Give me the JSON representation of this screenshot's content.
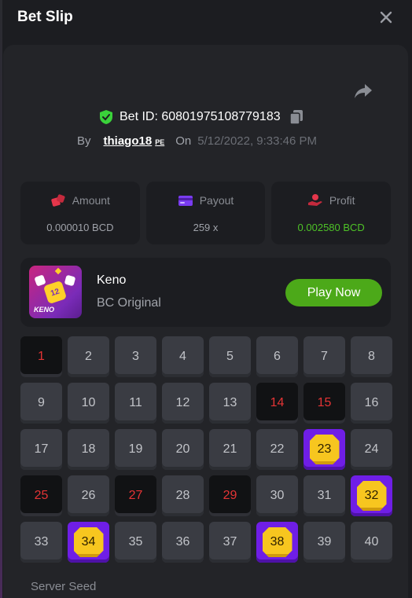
{
  "header": {
    "title": "Bet Slip",
    "close_icon": "close-icon"
  },
  "bet": {
    "id_text": "Bet ID: 60801975108779183",
    "by_label": "By",
    "username": "thiago18",
    "username_suffix": "PE",
    "on_label": "On",
    "datetime": "5/12/2022, 9:33:46 PM"
  },
  "stats": [
    {
      "label": "Amount",
      "value": "0.000010 BCD",
      "icon": "dice-icon",
      "color": "#e5364b"
    },
    {
      "label": "Payout",
      "value": "259 x",
      "icon": "card-icon",
      "color": "#7a3cf0"
    },
    {
      "label": "Profit",
      "value": "0.002580 BCD",
      "icon": "coin-hand-icon",
      "color": "#e5364b",
      "value_color": "#4ec227"
    }
  ],
  "game": {
    "name": "Keno",
    "subtitle": "BC Original",
    "thumb_number": "12",
    "thumb_label": "KENO",
    "play_label": "Play Now"
  },
  "board": {
    "numbers": [
      "1",
      "2",
      "3",
      "4",
      "5",
      "6",
      "7",
      "8",
      "9",
      "10",
      "11",
      "12",
      "13",
      "14",
      "15",
      "16",
      "17",
      "18",
      "19",
      "20",
      "21",
      "22",
      "23",
      "24",
      "25",
      "26",
      "27",
      "28",
      "29",
      "30",
      "31",
      "32",
      "33",
      "34",
      "35",
      "36",
      "37",
      "38",
      "39",
      "40"
    ],
    "missed": [
      "1",
      "14",
      "15",
      "25",
      "27",
      "29"
    ],
    "hits": [
      "23",
      "32",
      "34",
      "38"
    ]
  },
  "footer": {
    "server_seed_label": "Server Seed"
  },
  "colors": {
    "accent_green": "#4ca919",
    "miss_red": "#e53435",
    "hit_purple": "#6f1ee6",
    "gem_yellow": "#f7c61f"
  }
}
